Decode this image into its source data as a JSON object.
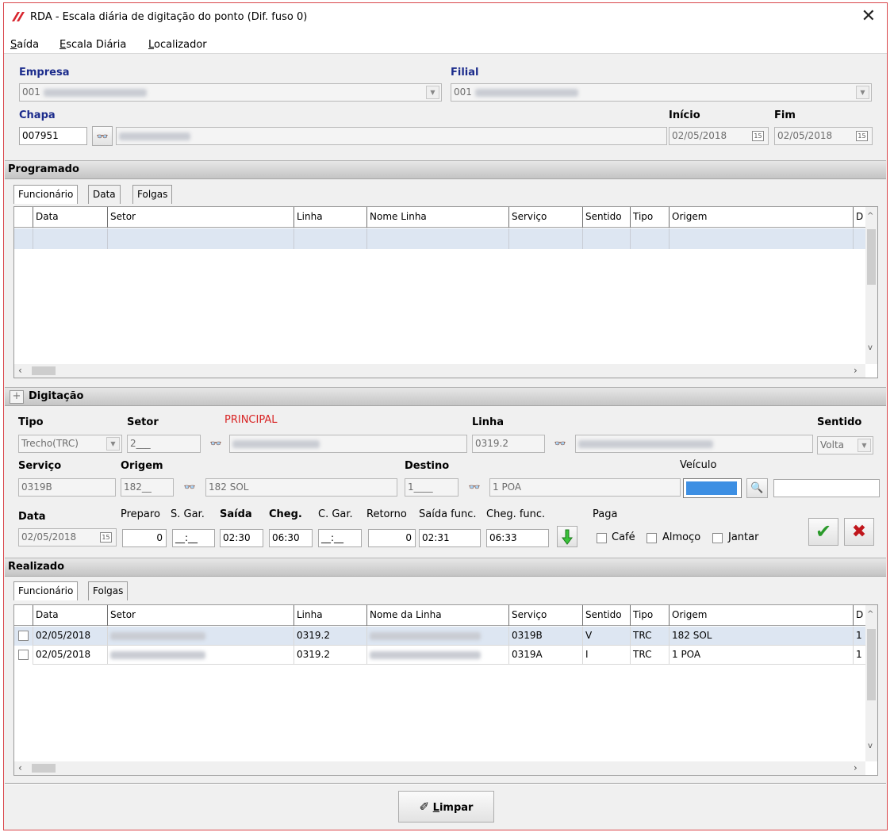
{
  "window": {
    "title": "RDA - Escala diária de digitação do ponto (Dif. fuso 0)",
    "close": "✕"
  },
  "menu": [
    {
      "label": "Saída",
      "key": "S"
    },
    {
      "label": "Escala Diária",
      "key": "E"
    },
    {
      "label": "Localizador",
      "key": "L"
    }
  ],
  "header": {
    "empresa_label": "Empresa",
    "empresa_code": "001",
    "filial_label": "Filial",
    "filial_code": "001",
    "chapa_label": "Chapa",
    "chapa_value": "007951",
    "inicio_label": "Início",
    "inicio_value": "02/05/2018",
    "fim_label": "Fim",
    "fim_value": "02/05/2018"
  },
  "programado": {
    "title": "Programado",
    "tabs": [
      "Funcionário",
      "Data",
      "Folgas"
    ],
    "columns": [
      "Data",
      "Setor",
      "Linha",
      "Nome Linha",
      "Serviço",
      "Sentido",
      "Tipo",
      "Origem",
      "D"
    ]
  },
  "digitacao": {
    "title": "Digitação",
    "expand": "+",
    "tipo_label": "Tipo",
    "tipo_value": "Trecho(TRC)",
    "setor_label": "Setor",
    "setor_value": "2___",
    "principal_label": "PRINCIPAL",
    "linha_label": "Linha",
    "linha_value": "0319.2",
    "sentido_label": "Sentido",
    "sentido_value": "Volta",
    "servico_label": "Serviço",
    "servico_value": "0319B",
    "origem_label": "Origem",
    "origem_code": "182__",
    "origem_name": "182 SOL",
    "destino_label": "Destino",
    "destino_code": "1____",
    "destino_name": "1 POA",
    "veiculo_label": "Veículo",
    "veiculo_color": "#3d8fe3",
    "data_label": "Data",
    "data_value": "02/05/2018",
    "preparo_label": "Preparo",
    "preparo_value": "0",
    "sgar_label": "S. Gar.",
    "sgar_value": "__:__",
    "saida_label": "Saída",
    "saida_value": "02:30",
    "cheg_label": "Cheg.",
    "cheg_value": "06:30",
    "cgar_label": "C. Gar.",
    "cgar_value": "__:__",
    "retorno_label": "Retorno",
    "retorno_value": "0",
    "saida_func_label": "Saída func.",
    "saida_func_value": "02:31",
    "cheg_func_label": "Cheg. func.",
    "cheg_func_value": "06:33",
    "paga_label": "Paga",
    "cafe_label": "Café",
    "almoco_label": "Almoço",
    "jantar_label": "Jantar",
    "confirm_icon": "✔",
    "cancel_icon": "✖"
  },
  "realizado": {
    "title": "Realizado",
    "tabs": [
      "Funcionário",
      "Folgas"
    ],
    "columns": [
      "Data",
      "Setor",
      "Linha",
      "Nome da Linha",
      "Serviço",
      "Sentido",
      "Tipo",
      "Origem",
      "D"
    ],
    "rows": [
      {
        "data": "02/05/2018",
        "linha": "0319.2",
        "servico": "0319B",
        "sentido": "V",
        "tipo": "TRC",
        "origem": "182 SOL",
        "d": "1"
      },
      {
        "data": "02/05/2018",
        "linha": "0319.2",
        "servico": "0319A",
        "sentido": "I",
        "tipo": "TRC",
        "origem": "1 POA",
        "d": "1"
      }
    ]
  },
  "footer": {
    "limpar_label": "Limpar",
    "limpar_key": "L"
  }
}
